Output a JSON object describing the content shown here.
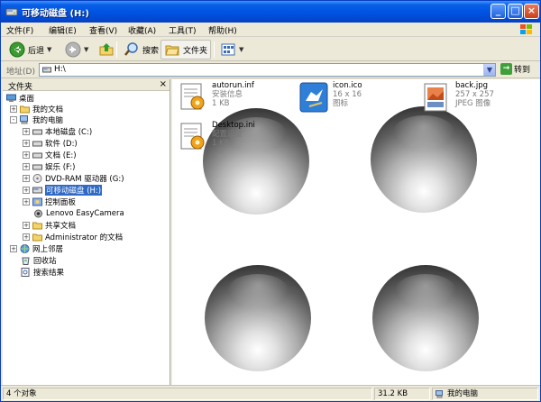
{
  "window": {
    "title": "可移动磁盘 (H:)"
  },
  "menu": [
    "文件(F)",
    "编辑(E)",
    "查看(V)",
    "收藏(A)",
    "工具(T)",
    "帮助(H)"
  ],
  "toolbar": {
    "back": "后退",
    "search": "搜索",
    "folders": "文件夹"
  },
  "address": {
    "label": "地址(D)",
    "value": "H:\\",
    "go": "转到"
  },
  "folder_pane": {
    "title": "文件夹",
    "tree": [
      {
        "label": "桌面",
        "expander": "",
        "icon": "desktop-icon"
      },
      {
        "label": "我的文档",
        "expander": "+",
        "icon": "folder-icon"
      },
      {
        "label": "我的电脑",
        "expander": "-",
        "icon": "computer-icon"
      },
      {
        "label": "本地磁盘 (C:)",
        "expander": "+",
        "icon": "drive-icon"
      },
      {
        "label": "软件 (D:)",
        "expander": "+",
        "icon": "drive-icon"
      },
      {
        "label": "文档 (E:)",
        "expander": "+",
        "icon": "drive-icon"
      },
      {
        "label": "娱乐 (F:)",
        "expander": "+",
        "icon": "drive-icon"
      },
      {
        "label": "DVD-RAM 驱动器 (G:)",
        "expander": "+",
        "icon": "cd-drive-icon"
      },
      {
        "label": "可移动磁盘 (H:)",
        "expander": "+",
        "icon": "removable-disk-icon"
      },
      {
        "label": "控制面板",
        "expander": "+",
        "icon": "control-panel-icon"
      },
      {
        "label": "Lenovo EasyCamera",
        "expander": "",
        "icon": "camera-icon"
      },
      {
        "label": "共享文档",
        "expander": "+",
        "icon": "folder-icon"
      },
      {
        "label": "Administrator 的文档",
        "expander": "+",
        "icon": "folder-icon"
      },
      {
        "label": "网上邻居",
        "expander": "+",
        "icon": "network-icon"
      },
      {
        "label": "回收站",
        "expander": "",
        "icon": "recycle-bin-icon"
      },
      {
        "label": "搜索结果",
        "expander": "",
        "icon": "search-results-icon"
      }
    ]
  },
  "files": [
    {
      "name": "autorun.inf",
      "type": "安装信息",
      "size": "1 KB",
      "icon": "setup-info-icon"
    },
    {
      "name": "icon.ico",
      "type": "16 x 16",
      "size": "图标",
      "icon": "bird-icon"
    },
    {
      "name": "back.jpg",
      "type": "257 x 257",
      "size": "JPEG 图像",
      "icon": "image-icon"
    },
    {
      "name": "Desktop.ini",
      "type": "配置设置",
      "size": "1 KB",
      "icon": "settings-file-icon"
    }
  ],
  "status": {
    "objects": "4 个对象",
    "size": "31.2 KB",
    "location": "我的电脑"
  },
  "colors": {
    "titlebar": "#0054e3",
    "selection": "#316ac5"
  }
}
